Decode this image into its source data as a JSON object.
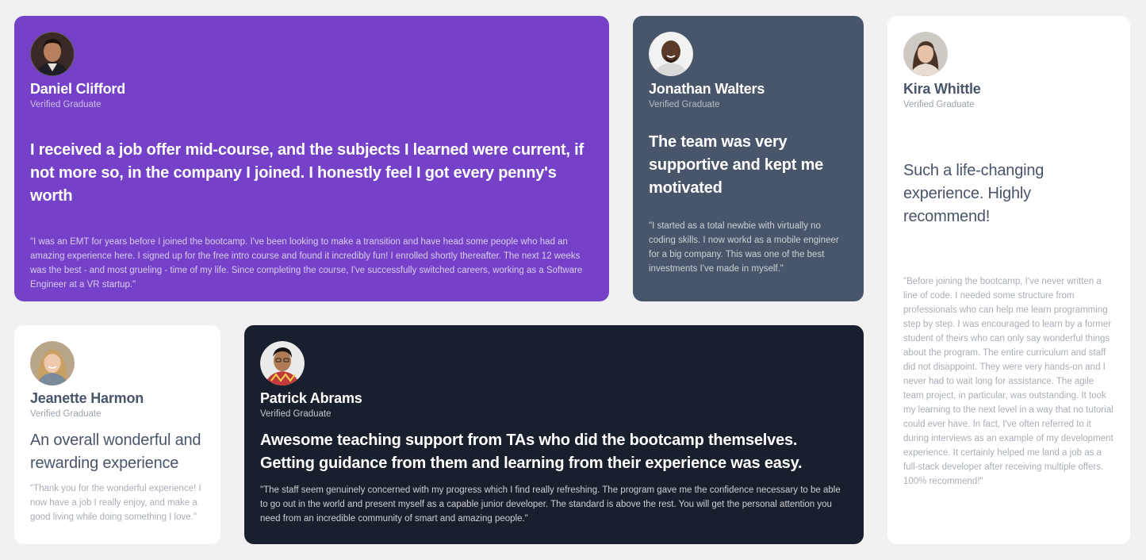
{
  "colors": {
    "page_background": "#f1f1f1",
    "purple": "#7541c8",
    "slate": "#48556a",
    "dark": "#19202d",
    "white": "#ffffff",
    "muted_text": "#a8adb7"
  },
  "testimonials": [
    {
      "name": "Daniel Clifford",
      "status": "Verified Graduate",
      "headline": "I received a job offer mid-course, and the subjects I learned were current, if not more so, in the company I joined. I honestly feel I got every penny's worth",
      "quote": "\"I was an EMT for years before I joined the bootcamp. I've been looking to make a transition and have head some people who had an amazing experience here. I signed up for the free intro course and found it incredibly fun! I enrolled shortly thereafter. The next 12 weeks was the best - and most grueling - time of my life. Since completing the course, I've successfully switched careers, working as a Software Engineer at a VR startup.\""
    },
    {
      "name": "Jonathan Walters",
      "status": "Verified Graduate",
      "headline": "The team was very supportive and kept me motivated",
      "quote": "\"I started as a total newbie with virtually no coding skills. I now workd as a mobile engineer for a big company. This was one of the best investments I've made in myself.\""
    },
    {
      "name": "Kira Whittle",
      "status": "Verified Graduate",
      "headline": "Such a life-changing experience. Highly recommend!",
      "quote": "\"Before joining the bootcamp, I've never written a line of code. I needed some structure from professionals who can help me learn programming step by step. I was encouraged to learn by a former student of theirs who can only say wonderful things about the program. The entire curriculum and staff did not disappoint. They were very hands-on and I never had to wait long for assistance. The agile team project, in particular, was outstanding. It took my learning to the next level in a way that no tutorial could ever have. In fact, I've often referred to it during interviews as an example of my development experience. It certainly helped me land a job as a full-stack developer after receiving multiple offers. 100% recommend!\""
    },
    {
      "name": "Jeanette Harmon",
      "status": "Verified Graduate",
      "headline": "An overall wonderful and rewarding experience",
      "quote": "\"Thank you for the wonderful experience! I now have a job I really enjoy, and make a good living while doing something I love.\""
    },
    {
      "name": "Patrick Abrams",
      "status": "Verified Graduate",
      "headline": "Awesome teaching support from TAs who did the bootcamp themselves. Getting guidance from them and learning from their experience was easy.",
      "quote": "\"The staff seem genuinely concerned with my progress which I find really refreshing. The program gave me the confidence necessary to be able to go out in the world and present myself as a capable junior developer. The standard is above the rest. You will get the personal attention you need from an incredible community of smart and amazing people.\""
    }
  ]
}
